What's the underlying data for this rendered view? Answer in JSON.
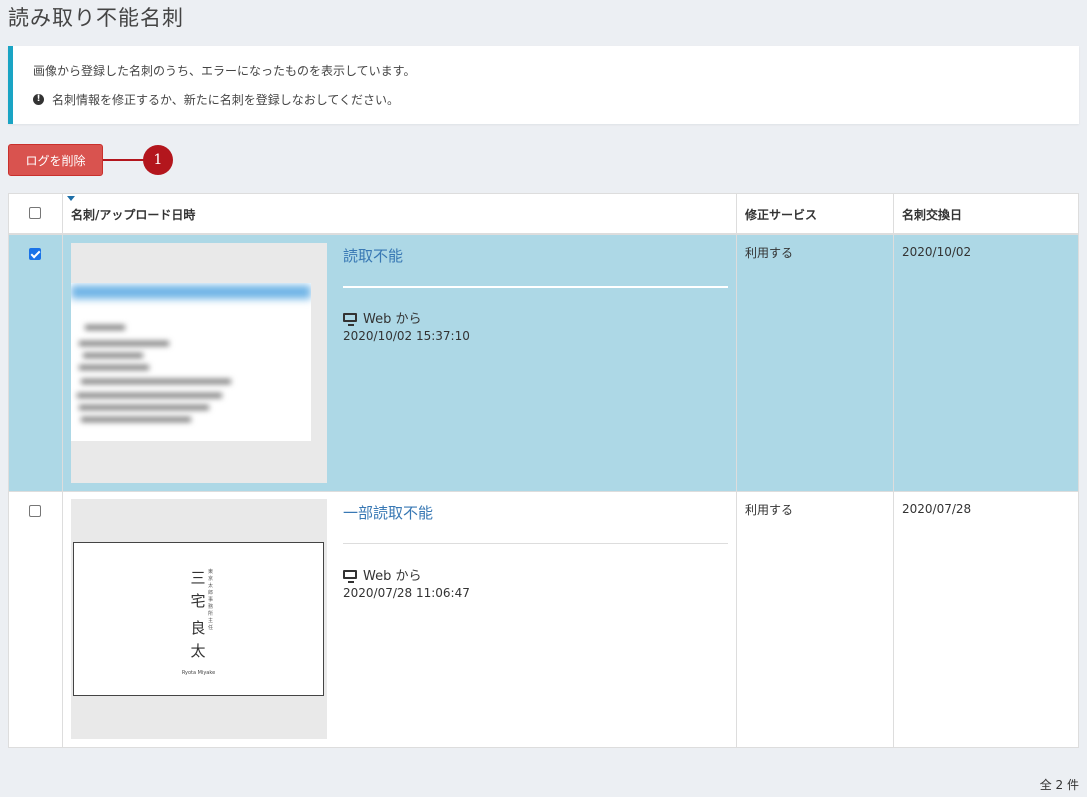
{
  "page": {
    "title": "読み取り不能名刺"
  },
  "info": {
    "line1": "画像から登録した名刺のうち、エラーになったものを表示しています。",
    "line2": "名刺情報を修正するか、新たに名刺を登録しなおしてください。",
    "warn_icon": "exclamation-circle-icon"
  },
  "toolbar": {
    "delete_label": "ログを削除"
  },
  "callout": {
    "number": "1",
    "color": "#b3161d"
  },
  "table": {
    "headers": [
      "名刺/アップロード日時",
      "修正サービス",
      "名刺交換日"
    ],
    "sorted_column": "名刺/アップロード日時",
    "rows": [
      {
        "checked": true,
        "title": "読取不能",
        "via": "Web から",
        "timestamp": "2020/10/02 15:37:10",
        "service": "利用する",
        "exchange_date": "2020/10/02",
        "highlight_color": "#add8e6"
      },
      {
        "checked": false,
        "title": "一部読取不能",
        "via": "Web から",
        "timestamp": "2020/07/28 11:06:47",
        "service": "利用する",
        "exchange_date": "2020/07/28",
        "card": {
          "name_lines": [
            "三",
            "宅",
            "良",
            "太"
          ],
          "romaji": "Ryota Miyake",
          "small_text": "東京太郎事務所 主任"
        }
      }
    ]
  },
  "footer": {
    "total": "全 2 件"
  },
  "colors": {
    "accent": "#1aa4c4",
    "danger": "#d9534f",
    "link": "#3878b4"
  }
}
